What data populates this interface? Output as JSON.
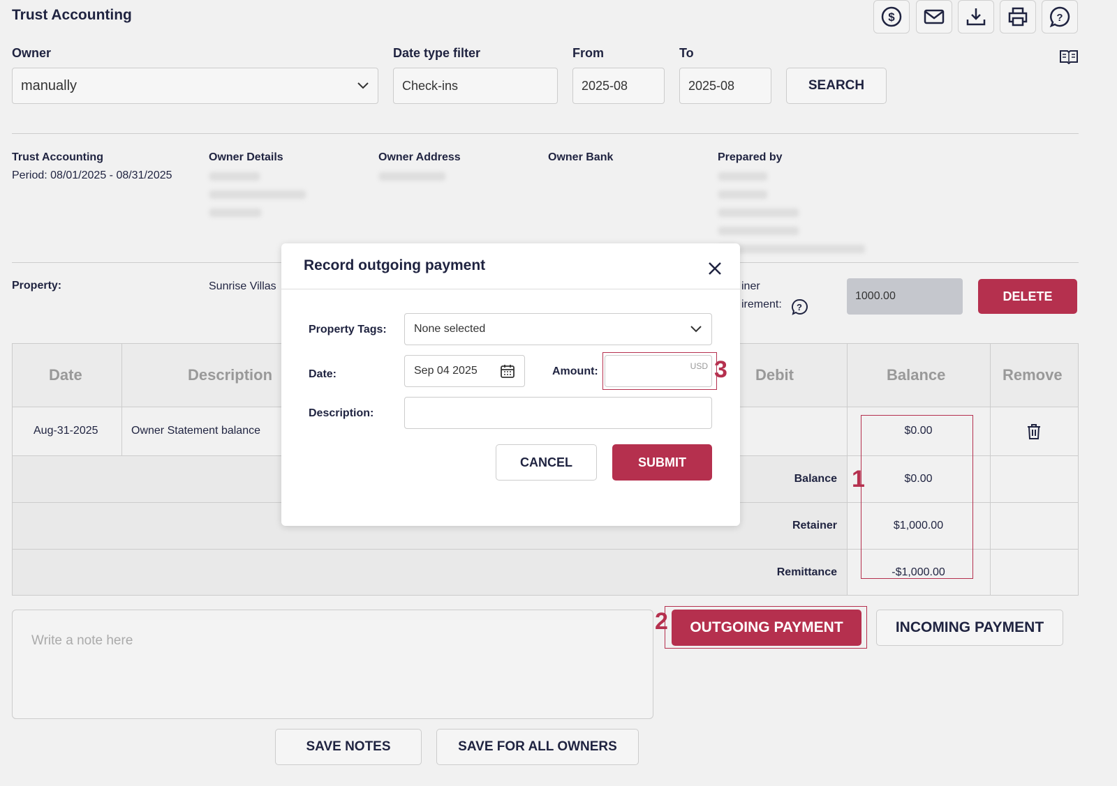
{
  "header": {
    "title": "Trust Accounting",
    "icons": [
      "dollar-icon",
      "mail-icon",
      "download-icon",
      "print-icon",
      "help-chat-icon"
    ]
  },
  "filters": {
    "owner_label": "Owner",
    "owner_value": "manually",
    "date_type_label": "Date type filter",
    "date_type_value": "Check-ins",
    "from_label": "From",
    "from_value": "2025-08",
    "to_label": "To",
    "to_value": "2025-08",
    "search_label": "SEARCH"
  },
  "summary": {
    "trust_title": "Trust Accounting",
    "period": "Period: 08/01/2025 - 08/31/2025",
    "owner_details": "Owner Details",
    "owner_address": "Owner Address",
    "owner_bank": "Owner Bank",
    "prepared_by": "Prepared by"
  },
  "property": {
    "label": "Property:",
    "value": "Sunrise Villas",
    "retainer_label_1": "iner",
    "retainer_label_2": "irement:",
    "retainer_value": "1000.00",
    "delete_label": "DELETE"
  },
  "table": {
    "headers": [
      "Date",
      "Description",
      "Debit",
      "Balance",
      "Remove"
    ],
    "row": {
      "date": "Aug-31-2025",
      "description": "Owner Statement balance",
      "balance": "$0.00"
    },
    "totals": [
      {
        "label": "Balance",
        "value": "$0.00"
      },
      {
        "label": "Retainer",
        "value": "$1,000.00"
      },
      {
        "label": "Remittance",
        "value": "-$1,000.00"
      }
    ]
  },
  "notes": {
    "placeholder": "Write a note here",
    "save_notes": "SAVE NOTES",
    "save_all": "SAVE FOR ALL OWNERS"
  },
  "payments": {
    "outgoing": "OUTGOING PAYMENT",
    "incoming": "INCOMING PAYMENT"
  },
  "modal": {
    "title": "Record outgoing payment",
    "property_tags_label": "Property Tags:",
    "property_tags_value": "None selected",
    "date_label": "Date:",
    "date_value": "Sep 04 2025",
    "amount_label": "Amount:",
    "amount_currency": "USD",
    "amount_value": "",
    "description_label": "Description:",
    "description_value": "",
    "cancel": "CANCEL",
    "submit": "SUBMIT"
  },
  "annotations": [
    "1",
    "2",
    "3"
  ],
  "colors": {
    "accent": "#b5304e",
    "background": "#f1f1f1"
  }
}
